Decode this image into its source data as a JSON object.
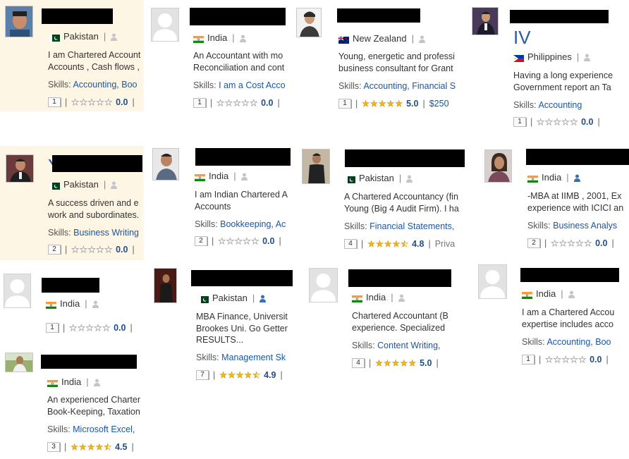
{
  "colors": {
    "link": "#1a56a6",
    "highlight_bg": "#fdf6e4",
    "star": "#f6b70f",
    "score": "#1f4e8c"
  },
  "cards": [
    {
      "country": "Pakistan",
      "flag": "pk",
      "user_icon": "user-gray-icon",
      "desc": [
        "I am Chartered Account",
        "Accounts , Cash flows ,"
      ],
      "skills_label": "Skills:",
      "skills": [
        "Accounting,",
        "Boo"
      ],
      "rank": "1",
      "rating": 0,
      "score": "0.0",
      "extra": ""
    },
    {
      "country": "India",
      "flag": "in",
      "user_icon": "user-gray-icon",
      "desc": [
        "An Accountant with mo",
        "Reconciliation and cont"
      ],
      "skills_label": "Skills:",
      "skills": [
        "I am a Cost Acco"
      ],
      "rank": "1",
      "rating": 0,
      "score": "0.0",
      "extra": ""
    },
    {
      "name_partial": "",
      "country": "New Zealand",
      "flag": "nz",
      "user_icon": "user-gray-icon",
      "desc": [
        "Young, energetic and professi",
        "business consultant for Grant"
      ],
      "skills_label": "Skills:",
      "skills": [
        "Accounting,",
        "Financial S"
      ],
      "rank": "1",
      "rating": 5,
      "score": "5.0",
      "extra": "$250"
    },
    {
      "name_partial": "IV",
      "country": "Philippines",
      "flag": "ph",
      "user_icon": "user-gray-icon",
      "desc": [
        "Having a long experience",
        "Government report an Ta"
      ],
      "skills_label": "Skills:",
      "skills": [
        "Accounting"
      ],
      "rank": "1",
      "rating": 0,
      "score": "0.0",
      "extra": ""
    },
    {
      "name_partial": "Y",
      "country": "Pakistan",
      "flag": "pk",
      "user_icon": "user-gray-icon",
      "desc": [
        "A success driven and e",
        "work and subordinates."
      ],
      "skills_label": "Skills:",
      "skills": [
        "Business Writing"
      ],
      "rank": "2",
      "rating": 0,
      "score": "0.0",
      "extra": ""
    },
    {
      "country": "India",
      "flag": "in",
      "user_icon": "user-gray-icon",
      "desc": [
        "I am Indian Chartered A",
        "Accounts"
      ],
      "skills_label": "Skills:",
      "skills": [
        "Bookkeeping,",
        "Ac"
      ],
      "rank": "2",
      "rating": 0,
      "score": "0.0",
      "extra": ""
    },
    {
      "country": "Pakistan",
      "flag": "pk",
      "user_icon": "user-gray-icon",
      "desc": [
        "A Chartered Accountancy (fin",
        "Young (Big 4 Audit Firm). I ha"
      ],
      "skills_label": "Skills:",
      "skills": [
        "Financial Statements,"
      ],
      "rank": "4",
      "rating": 4.5,
      "score": "4.8",
      "extra": "Priva"
    },
    {
      "country": "India",
      "flag": "in",
      "user_icon": "user-blue-icon",
      "desc": [
        "-MBA at IIMB , 2001, Ex",
        "experience with ICICI an"
      ],
      "skills_label": "Skills:",
      "skills": [
        "Business Analys"
      ],
      "rank": "2",
      "rating": 0,
      "score": "0.0",
      "extra": ""
    },
    {
      "country": "India",
      "flag": "in",
      "user_icon": "user-gray-icon",
      "desc": [],
      "skills_label": "",
      "skills": [],
      "rank": "1",
      "rating": 0,
      "score": "0.0",
      "extra": ""
    },
    {
      "country": "Pakistan",
      "flag": "pk",
      "user_icon": "user-blue-icon",
      "desc": [
        "MBA Finance, Universit",
        "Brookes Uni. Go Getter",
        "RESULTS..."
      ],
      "skills_label": "Skills:",
      "skills": [
        "Management Sk"
      ],
      "rank": "7",
      "rating": 4.5,
      "score": "4.9",
      "extra": ""
    },
    {
      "country": "India",
      "flag": "in",
      "user_icon": "user-gray-icon",
      "desc": [
        "Chartered Accountant (B",
        "experience. Specialized"
      ],
      "skills_label": "Skills:",
      "skills": [
        "Content Writing,"
      ],
      "rank": "4",
      "rating": 5,
      "score": "5.0",
      "extra": ""
    },
    {
      "country": "India",
      "flag": "in",
      "user_icon": "user-gray-icon",
      "desc": [
        "I am a Chartered Accou",
        "expertise includes acco"
      ],
      "skills_label": "Skills:",
      "skills": [
        "Accounting,",
        "Boo"
      ],
      "rank": "1",
      "rating": 0,
      "score": "0.0",
      "extra": ""
    },
    {
      "country": "India",
      "flag": "in",
      "user_icon": "user-gray-icon",
      "desc": [
        "An experienced Charter",
        "Book-Keeping, Taxation"
      ],
      "skills_label": "Skills:",
      "skills": [
        "Microsoft Excel,"
      ],
      "rank": "3",
      "rating": 4.5,
      "score": "4.5",
      "extra": ""
    }
  ]
}
